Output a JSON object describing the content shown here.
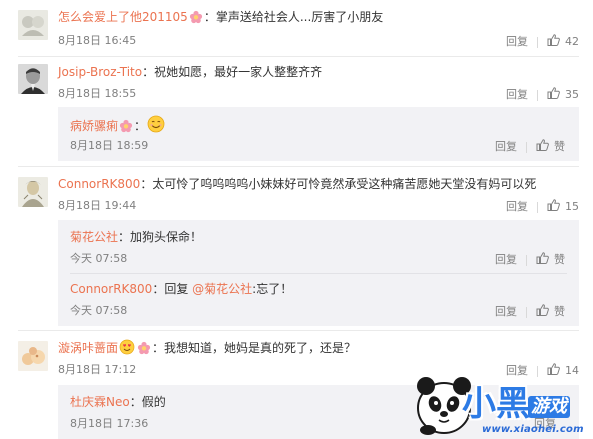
{
  "comments": [
    {
      "username": "怎么会爱上了他201105",
      "text": "：掌声送给社会人...厉害了小朋友",
      "time": "8月18日 16:45",
      "reply_label": "回复",
      "likes": "42"
    },
    {
      "username": "Josip-Broz-Tito",
      "text": "：祝她如愿，最好一家人整整齐齐",
      "time": "8月18日 18:55",
      "reply_label": "回复",
      "likes": "35",
      "replies": [
        {
          "username": "病娇骡痢",
          "text": "：",
          "time": "8月18日 18:59",
          "reply_label": "回复",
          "like_label": "赞"
        }
      ]
    },
    {
      "username": "ConnorRK800",
      "text": "：太可怜了呜呜呜呜小妹妹好可怜竟然承受这种痛苦愿她天堂没有妈可以死",
      "time": "8月18日 19:44",
      "reply_label": "回复",
      "likes": "15",
      "replies": [
        {
          "username": "菊花公社",
          "text": "：加狗头保命！",
          "time": "今天 07:58",
          "reply_label": "回复",
          "like_label": "赞"
        },
        {
          "username": "ConnorRK800",
          "prefix": "：回复 ",
          "mention": "@菊花公社",
          "text": ":忘了！",
          "time": "今天 07:58",
          "reply_label": "回复",
          "like_label": "赞"
        }
      ]
    },
    {
      "username": "漩涡咔蔷面",
      "text": "：我想知道，她妈是真的死了，还是？",
      "time": "8月18日 17:12",
      "reply_label": "回复",
      "likes": "14",
      "replies": [
        {
          "username": "杜庆霖Neo",
          "text": "：假的",
          "time": "8月18日 17:36",
          "reply_label": "回复"
        }
      ]
    }
  ],
  "watermark": {
    "site": "www.xiaohei.com",
    "logo_text": "小黑",
    "logo_tag": "游戏"
  },
  "colors": {
    "username": "#eb7350",
    "text": "#333333",
    "meta": "#808080",
    "reply_bg": "#f2f2f5",
    "watermark_blue": "#2d7be5"
  }
}
